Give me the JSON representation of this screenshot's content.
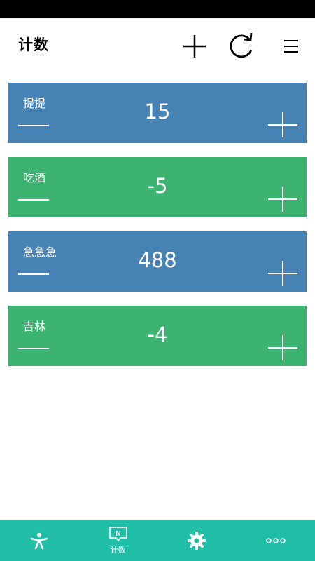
{
  "header": {
    "title": "计数"
  },
  "counters": [
    {
      "name": "提提",
      "value": "15",
      "color": "#4682b4"
    },
    {
      "name": "吃酒",
      "value": "-5",
      "color": "#3cb371"
    },
    {
      "name": "急急急",
      "value": "488",
      "color": "#4682b4"
    },
    {
      "name": "吉林",
      "value": "-4",
      "color": "#3cb371"
    }
  ],
  "nav": {
    "items": [
      {
        "icon": "person-icon",
        "label": ""
      },
      {
        "icon": "counter-icon",
        "label": "计数",
        "icon_letter": "N"
      },
      {
        "icon": "gear-icon",
        "label": ""
      },
      {
        "icon": "more-icon",
        "label": ""
      }
    ],
    "color": "#22bfa8"
  }
}
